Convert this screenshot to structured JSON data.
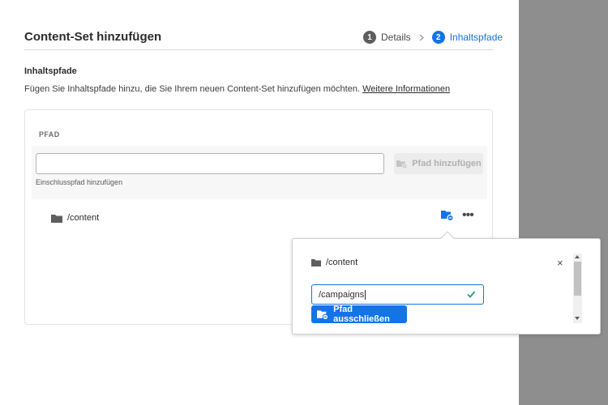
{
  "dialog": {
    "title": "Content-Set hinzufügen",
    "steps": [
      {
        "number": "1",
        "label": "Details"
      },
      {
        "number": "2",
        "label": "Inhaltspfade"
      }
    ]
  },
  "section": {
    "heading": "Inhaltspfade",
    "description": "Fügen Sie Inhaltspfade hinzu, die Sie Ihrem neuen Content-Set hinzufügen möchten.",
    "link_label": "Weitere Informationen"
  },
  "path_table": {
    "column_header": "PFAD",
    "input_value": "",
    "input_help": "Einschlusspfad hinzufügen",
    "add_button_label": "Pfad hinzufügen",
    "rows": [
      {
        "path": "/content",
        "icons": [
          "folder-icon",
          "exclude-folder-icon",
          "more-icon"
        ]
      }
    ]
  },
  "popover": {
    "path": "/content",
    "close_glyph": "×",
    "exclude_input_value": "/campaigns",
    "exclude_button_label": "Pfad ausschließen"
  },
  "colors": {
    "accent": "#1473e6",
    "valid": "#2d9d78",
    "overlay_gray": "#8e8e8e"
  }
}
